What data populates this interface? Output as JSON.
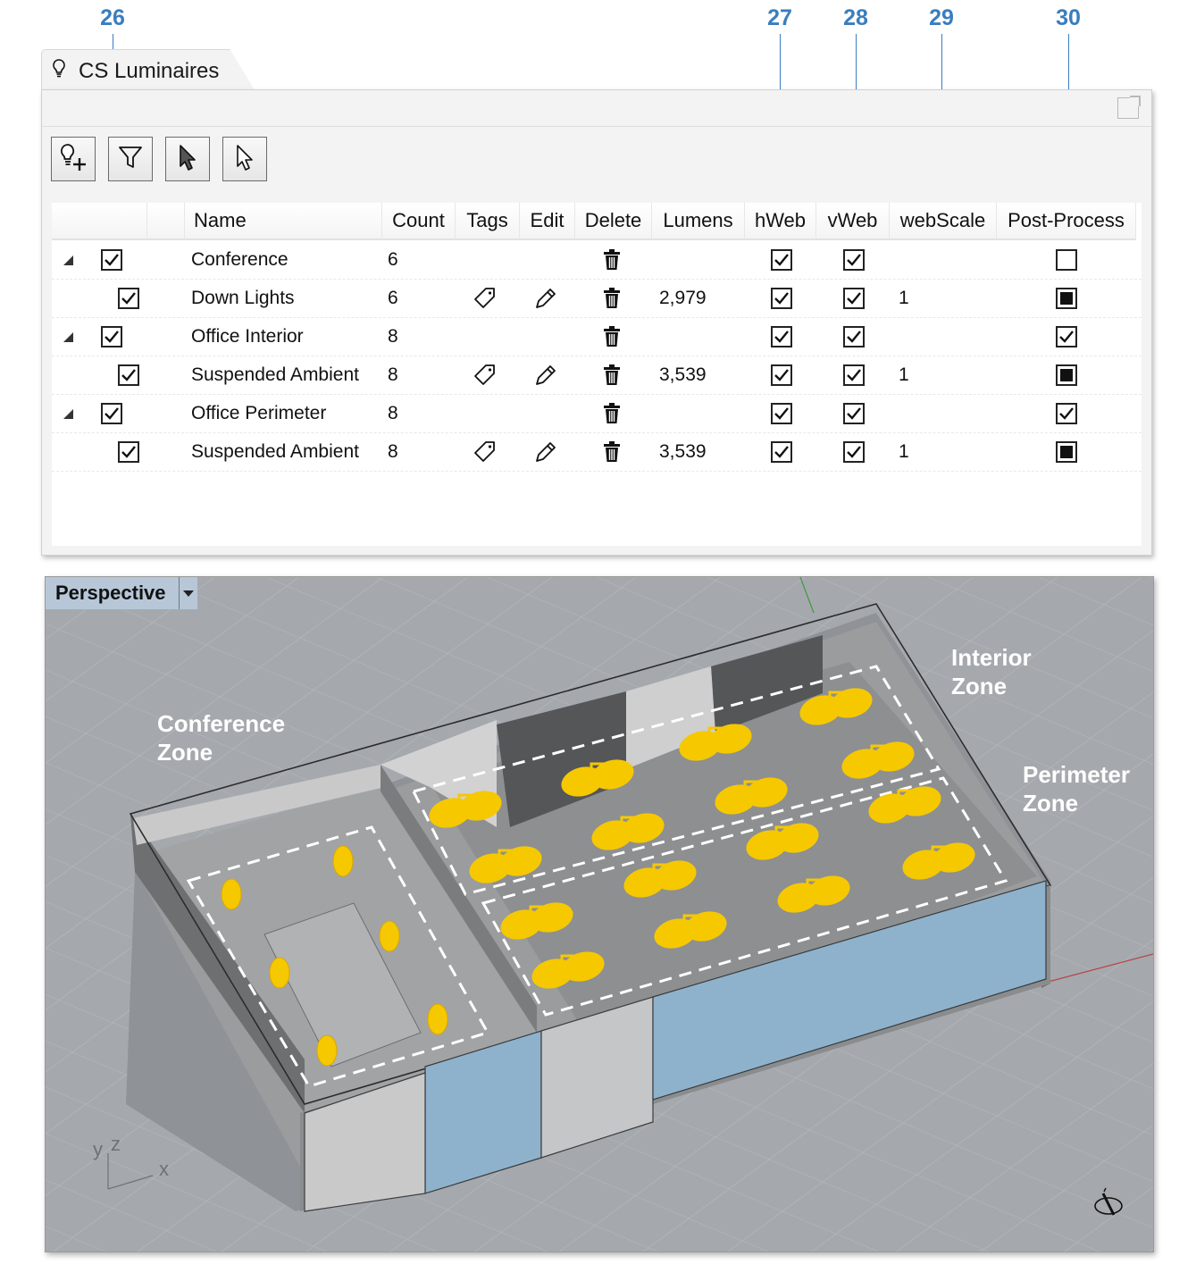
{
  "callouts": [
    "26",
    "27",
    "28",
    "29",
    "30"
  ],
  "panel": {
    "title": "CS Luminaires",
    "title_icon": "lightbulb-icon",
    "toolbar": [
      "add-luminaire-icon",
      "filter-icon",
      "select-arrow-icon",
      "select-outline-arrow-icon"
    ]
  },
  "columns": [
    "Name",
    "Count",
    "Tags",
    "Edit",
    "Delete",
    "Lumens",
    "hWeb",
    "vWeb",
    "webScale",
    "Post-Process"
  ],
  "rows": [
    {
      "level": 0,
      "name": "Conference",
      "count": "6",
      "tags": false,
      "edit": false,
      "lumens": "",
      "checked": true,
      "hweb": true,
      "vweb": true,
      "webscale": "",
      "post": "empty"
    },
    {
      "level": 1,
      "name": "Down Lights",
      "count": "6",
      "tags": true,
      "edit": true,
      "lumens": "2,979",
      "checked": true,
      "hweb": true,
      "vweb": true,
      "webscale": "1",
      "post": "filled"
    },
    {
      "level": 0,
      "name": "Office Interior",
      "count": "8",
      "tags": false,
      "edit": false,
      "lumens": "",
      "checked": true,
      "hweb": true,
      "vweb": true,
      "webscale": "",
      "post": "check"
    },
    {
      "level": 1,
      "name": "Suspended Ambient",
      "count": "8",
      "tags": true,
      "edit": true,
      "lumens": "3,539",
      "checked": true,
      "hweb": true,
      "vweb": true,
      "webscale": "1",
      "post": "filled"
    },
    {
      "level": 0,
      "name": "Office Perimeter",
      "count": "8",
      "tags": false,
      "edit": false,
      "lumens": "",
      "checked": true,
      "hweb": true,
      "vweb": true,
      "webscale": "",
      "post": "check"
    },
    {
      "level": 1,
      "name": "Suspended Ambient",
      "count": "8",
      "tags": true,
      "edit": true,
      "lumens": "3,539",
      "checked": true,
      "hweb": true,
      "vweb": true,
      "webscale": "1",
      "post": "filled"
    }
  ],
  "viewport": {
    "label": "Perspective",
    "zones": {
      "conference": [
        "Conference",
        "Zone"
      ],
      "interior": [
        "Interior",
        "Zone"
      ],
      "perimeter": [
        "Perimeter",
        "Zone"
      ]
    },
    "axes": {
      "y": "y",
      "z": "z",
      "x": "x"
    },
    "luminaire_color": "#f6c800"
  }
}
